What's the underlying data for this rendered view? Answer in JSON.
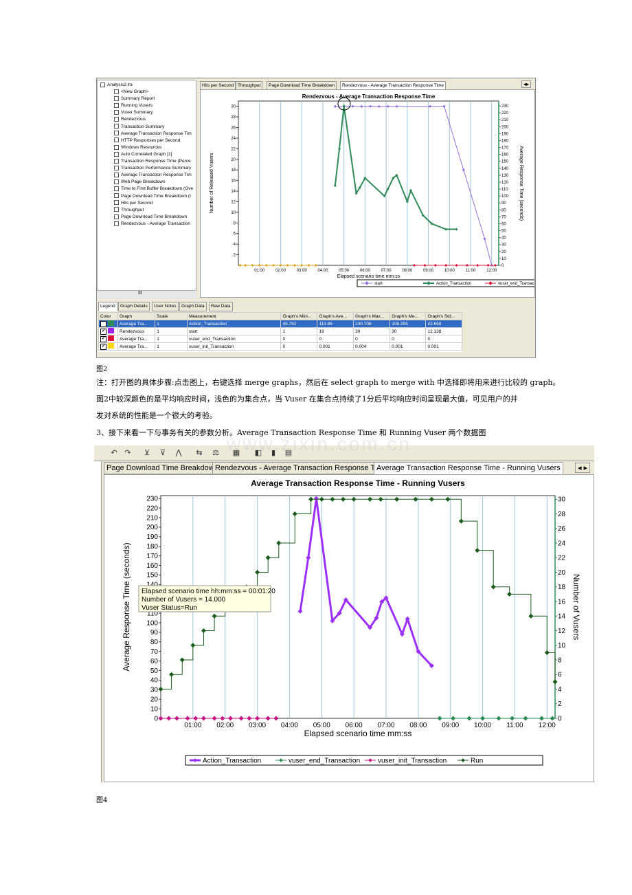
{
  "shot1": {
    "tree": {
      "root": "Analysis2.lra",
      "items": [
        "<New Graph>",
        "Summary Report",
        "Running Vusers",
        "Vuser Summary",
        "Rendezvous",
        "Transaction Summary",
        "Average Transaction Response Tim",
        "HTTP Responses per Second",
        "Windows Resources",
        "Auto Correlated Graph [1]",
        "Transaction Response Time (Perce",
        "Transaction Performance Summary",
        "Average Transaction Response Tim",
        "Web Page Breakdown",
        "Time to First Buffer Breakdown (Ove",
        "Page Download Time Breakdown (I",
        "Hits per Second",
        "Throughput",
        "Page Download Time Breakdown",
        "Rendezvous - Average Transaction"
      ],
      "scroll_label": "III"
    },
    "tabs": [
      "Hits per Second",
      "Throughput",
      "Page Download Time Breakdown",
      "Rendezvous - Average Transaction Response Time"
    ],
    "bottom_tabs": [
      "Legend",
      "Graph Details",
      "User Notes",
      "Graph Data",
      "Raw Data"
    ],
    "legend_table": {
      "headers": [
        "Color",
        "Graph",
        "Scale",
        "Measurement",
        "Graph's Mini...",
        "Graph's Ave...",
        "Graph's Max...",
        "Graph's Me...",
        "Graph's Std..."
      ],
      "rows": [
        {
          "color": "#2e8b57",
          "graph": "Average Tra...",
          "scale": "1",
          "measurement": "Action_Transaction",
          "min": "45.792",
          "avg": "113.96",
          "max": "230.708",
          "med": "109.255",
          "std": "42.659"
        },
        {
          "color": "#a020f0",
          "graph": "Rendezvous",
          "scale": "1",
          "measurement": "start",
          "min": "1",
          "avg": "19",
          "max": "30",
          "med": "30",
          "std": "12.138"
        },
        {
          "color": "#dc143c",
          "graph": "Average Tra...",
          "scale": "1",
          "measurement": "vuser_end_Transaction",
          "min": "0",
          "avg": "0",
          "max": "0",
          "med": "0",
          "std": "0"
        },
        {
          "color": "#ffd700",
          "graph": "Average Tra...",
          "scale": "1",
          "measurement": "vuser_init_Transaction",
          "min": "0",
          "avg": "0.001",
          "max": "0.004",
          "med": "0.001",
          "std": "0.001"
        }
      ]
    },
    "nav_arrows": [
      "◂",
      "▸"
    ]
  },
  "caption1": "图2",
  "paragraph1": [
    "注：打开图的具体步骤:点击图上，右键选择 merge graphs，然后在 select graph to merge with 中选择即将用来进行比较的 graph。",
    "图2中较深颜色的是平均响应时间，浅色的为集合点，当 Vuser 在集合点持续了1分后平均响应时间呈现最大值，可见用户的并",
    "发对系统的性能是一个很大的考验。"
  ],
  "paragraph2": "3、接下来看一下与事务有关的参数分析。Average Transaction Response Time 和 Running Vuser 两个数据图",
  "shot2": {
    "tabs": [
      "Page Download Time Breakdown",
      "Rendezvous - Average Transaction Response Time",
      "Average Transaction Response Time - Running Vusers"
    ],
    "nav_arrows": [
      "◂",
      "▸"
    ],
    "toolbar_icons": [
      "undo-icon",
      "redo-icon",
      "filter-icon",
      "clear-filter-icon",
      "granularity-icon",
      "merge-icon",
      "compare-icon",
      "table-icon",
      "legend-icon",
      "bar-icon",
      "stacked-icon"
    ],
    "tooltip": [
      "Elapsed scenario time hh:mm:ss = 00:01:20",
      "Number of Vusers = 14.000",
      "Vuser Status=Run"
    ]
  },
  "caption2": "图4",
  "chart_data": [
    {
      "type": "line",
      "title": "Rendezvous - Average Transaction Response Time",
      "xlabel": "Elapsed scenario time mm:ss",
      "ylabel": "Number of Released Vusers",
      "y2label": "Average Response Time (seconds)",
      "x_ticks": [
        "01:00",
        "02:00",
        "03:00",
        "04:00",
        "05:00",
        "06:00",
        "07:00",
        "08:00",
        "09:00",
        "10:00",
        "11:00",
        "12:00"
      ],
      "y_ticks": [
        2,
        4,
        6,
        8,
        10,
        12,
        14,
        16,
        18,
        20,
        22,
        24,
        26,
        28,
        30
      ],
      "y2_ticks": [
        0,
        10,
        20,
        30,
        40,
        50,
        60,
        70,
        80,
        90,
        100,
        110,
        120,
        130,
        140,
        150,
        160,
        170,
        180,
        190,
        200,
        210,
        220,
        230
      ],
      "ylim": [
        0,
        31
      ],
      "y2lim": [
        0,
        237
      ],
      "xlim_seconds": [
        0,
        740
      ],
      "series": [
        {
          "name": "start",
          "axis": "left",
          "color": "#9370db",
          "x": [
            270,
            290,
            310,
            330,
            350,
            370,
            390,
            410,
            430,
            450,
            470,
            490,
            510,
            530,
            550,
            570,
            590,
            610,
            630,
            650,
            670,
            690,
            710,
            730
          ],
          "y": [
            30,
            30,
            30,
            30,
            30,
            30,
            30,
            30,
            30,
            30,
            30,
            30,
            30,
            30,
            30,
            30,
            30,
            30,
            30,
            30,
            30,
            30,
            30,
            30
          ],
          "x_sec": [
            275,
            300,
            325,
            350,
            375,
            400,
            425,
            450,
            545,
            585,
            640,
            700,
            720
          ],
          "y_vals": [
            30,
            30,
            30,
            30,
            30,
            30,
            30,
            30,
            30,
            30,
            18,
            5,
            0
          ]
        },
        {
          "name": "Action_Transaction",
          "axis": "right",
          "color": "#2e8b57",
          "x_sec": [
            275,
            287,
            300,
            335,
            345,
            360,
            415,
            425,
            440,
            450,
            480,
            490,
            525,
            550,
            590,
            620
          ],
          "y_vals": [
            115,
            168,
            230,
            104,
            112,
            126,
            100,
            110,
            126,
            130,
            92,
            108,
            72,
            60,
            52,
            52
          ]
        },
        {
          "name": "vuser_end_Transaction",
          "axis": "right",
          "color": "#dc143c",
          "x_sec": [
            500,
            530,
            560,
            590,
            620,
            650,
            680,
            710,
            730
          ],
          "y_vals": [
            0,
            0,
            0,
            0,
            0,
            0,
            0,
            0,
            0
          ]
        },
        {
          "name": "vuser_init_Transaction",
          "axis": "right",
          "color": "#daa520",
          "x_sec": [
            5,
            20,
            40,
            60,
            80,
            100,
            120,
            140,
            160,
            180,
            200,
            220
          ],
          "y_vals": [
            0,
            0,
            0,
            0,
            0,
            0,
            0,
            0,
            0,
            0,
            0,
            0
          ]
        }
      ],
      "legend": [
        "start",
        "Action_Transaction",
        "vuser_end_Transaction",
        "vuser_init_Transaction"
      ]
    },
    {
      "type": "line",
      "title": "Average Transaction Response Time - Running Vusers",
      "xlabel": "Elapsed scenario time mm:ss",
      "ylabel": "Average Response Time (seconds)",
      "y2label": "Number of Vusers",
      "x_ticks": [
        "01:00",
        "02:00",
        "03:00",
        "04:00",
        "05:00",
        "06:00",
        "07:00",
        "08:00",
        "09:00",
        "10:00",
        "11:00",
        "12:00"
      ],
      "y_ticks": [
        0,
        10,
        20,
        30,
        40,
        50,
        60,
        70,
        80,
        90,
        100,
        110,
        120,
        130,
        140,
        150,
        160,
        170,
        180,
        190,
        200,
        210,
        220,
        230
      ],
      "y2_ticks": [
        0,
        2,
        4,
        6,
        8,
        10,
        12,
        14,
        16,
        18,
        20,
        22,
        24,
        26,
        28,
        30
      ],
      "ylim": [
        0,
        233
      ],
      "y2lim": [
        0,
        30.5
      ],
      "xlim_seconds": [
        0,
        735
      ],
      "series": [
        {
          "name": "Action_Transaction",
          "axis": "left",
          "color": "#9b30ff",
          "x_sec": [
            260,
            275,
            290,
            320,
            333,
            345,
            390,
            402,
            412,
            420,
            450,
            460,
            480,
            505
          ],
          "y_vals": [
            112,
            168,
            230,
            102,
            110,
            124,
            95,
            105,
            122,
            126,
            88,
            104,
            70,
            55
          ]
        },
        {
          "name": "vuser_end_Transaction",
          "axis": "left",
          "color": "#2e8b57",
          "x_sec": [
            520,
            545,
            575,
            600,
            630,
            655,
            680,
            710,
            730
          ],
          "y_vals": [
            0,
            0,
            0,
            0,
            0,
            0,
            0,
            0,
            0
          ]
        },
        {
          "name": "vuser_init_Transaction",
          "axis": "left",
          "color": "#c71585",
          "x_sec": [
            0,
            15,
            30,
            50,
            65,
            80,
            100,
            115,
            130,
            150,
            165,
            180,
            200,
            215
          ],
          "y_vals": [
            0,
            0,
            0,
            0,
            0,
            0,
            0,
            0,
            0,
            0,
            0,
            0,
            0,
            0
          ]
        },
        {
          "name": "Run",
          "axis": "right",
          "color": "#1a5c1a",
          "x_sec": [
            0,
            20,
            40,
            60,
            80,
            100,
            120,
            140,
            160,
            180,
            200,
            220,
            250,
            280,
            300,
            320,
            340,
            360,
            390,
            410,
            440,
            475,
            505,
            535,
            560,
            590,
            620,
            650,
            690,
            720,
            735
          ],
          "y_vals": [
            4,
            6,
            8,
            10,
            12,
            14,
            15,
            16,
            18,
            20,
            22,
            24,
            28,
            30,
            30,
            30,
            30,
            30,
            30,
            30,
            30,
            30,
            30,
            30,
            27,
            23,
            18,
            17,
            14,
            9,
            5
          ]
        }
      ],
      "legend": [
        "Action_Transaction",
        "vuser_end_Transaction",
        "vuser_init_Transaction",
        "Run"
      ]
    }
  ],
  "watermark": "www.zixin.com.cn"
}
